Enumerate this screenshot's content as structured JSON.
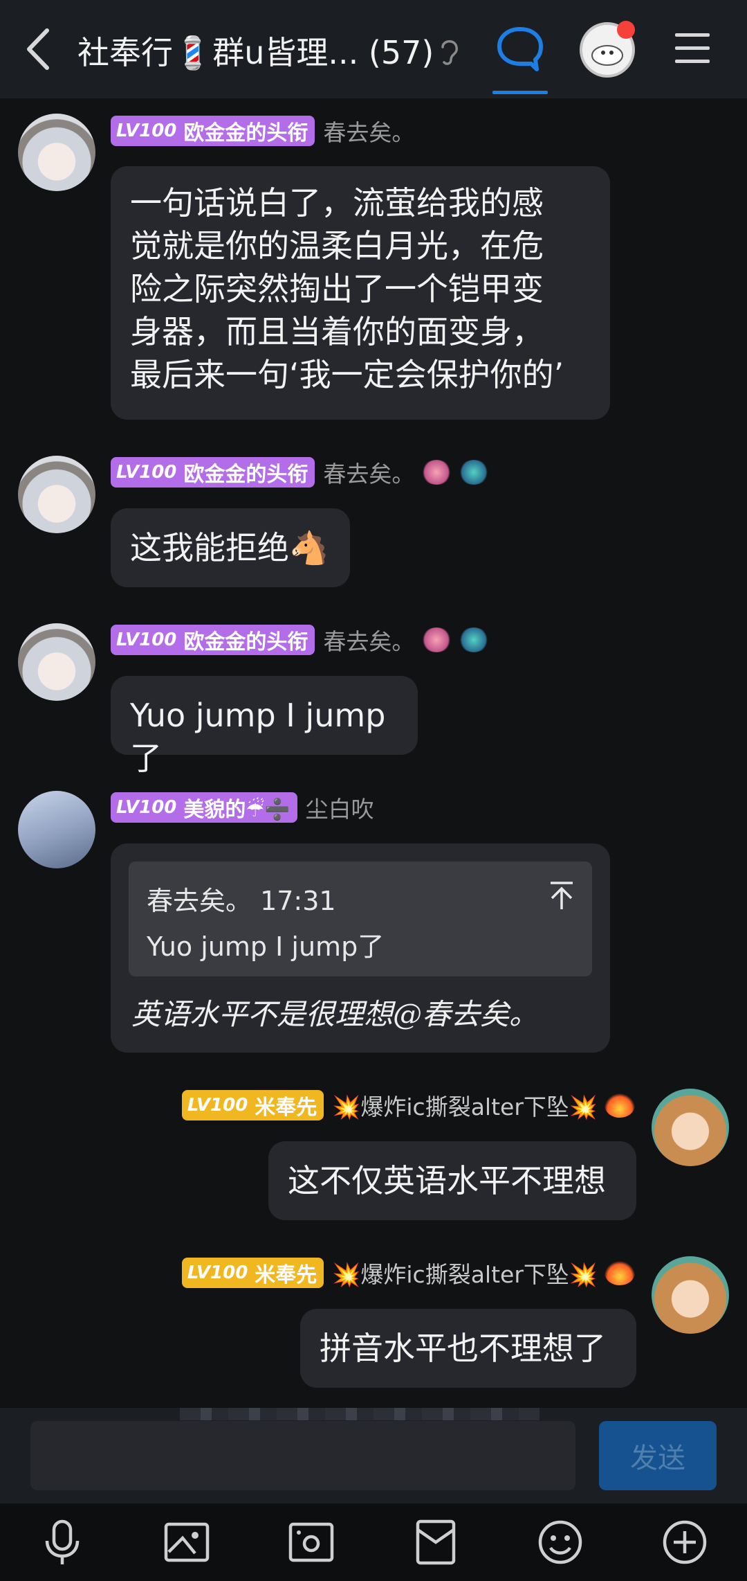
{
  "header": {
    "title": "社奉行💈群u皆理... (57)",
    "icons": [
      "back-icon",
      "ear-icon",
      "chat-icon",
      "avatar",
      "menu-icon"
    ]
  },
  "messages": [
    {
      "level": "LV100",
      "title": "欧金金的头衔",
      "nick": "春去矣。",
      "text_lines": [
        "一句话说白了，流萤给我的感",
        "觉就是你的温柔白月光，在危",
        "险之际突然掏出了一个铠甲变",
        "身器，而且当着你的面变身，",
        "最后来一句‘我一定会保护你的’"
      ]
    },
    {
      "level": "LV100",
      "title": "欧金金的头衔",
      "nick": "春去矣。",
      "text": "这我能拒绝🐴"
    },
    {
      "level": "LV100",
      "title": "欧金金的头衔",
      "nick": "春去矣。",
      "text": "Yuo jump I jump了"
    },
    {
      "level": "LV100",
      "title": "美貌的☔➗",
      "nick": "尘白吹",
      "quote_head": "春去矣。 17:31",
      "quote_body": "Yuo jump I jump了",
      "text": "英语水平不是很理想@春去矣。"
    },
    {
      "level": "LV100",
      "title": "米奉先",
      "nick": "💥爆炸ic撕裂alter下坠💥",
      "text": "这不仅英语水平不理想"
    },
    {
      "level": "LV100",
      "title": "米奉先",
      "nick": "💥爆炸ic撕裂alter下坠💥",
      "text": "拼音水平也不理想了"
    }
  ],
  "input": {
    "placeholder": "",
    "send_label": "发送"
  },
  "toolbar": {
    "icons": [
      "microphone-icon",
      "image-icon",
      "camera-icon",
      "red-packet-icon",
      "emoji-icon",
      "plus-icon"
    ]
  },
  "colors": {
    "accent": "#1d7fe4",
    "badge_purple": "#b36de8",
    "badge_gold": "#f1b721",
    "send": "#15528f"
  }
}
